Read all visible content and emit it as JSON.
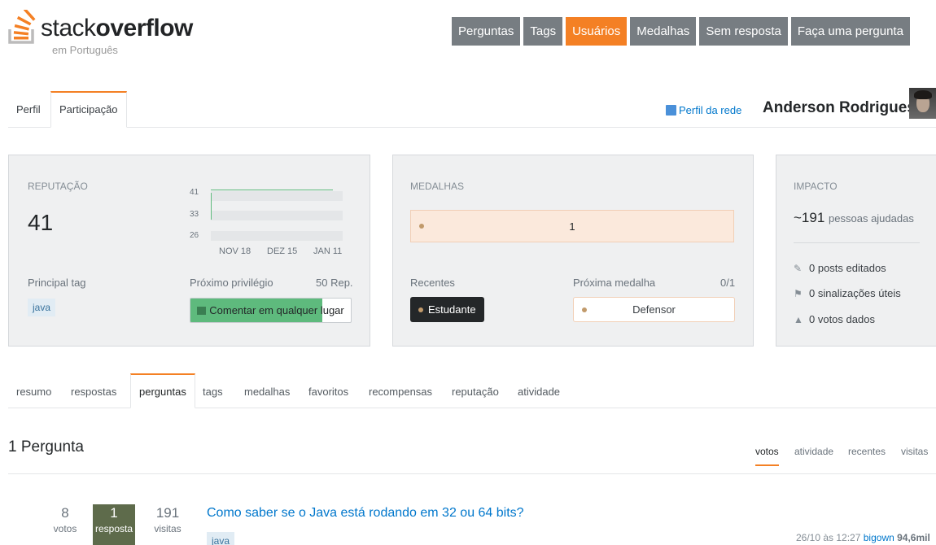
{
  "header": {
    "logo_text_normal": "stack",
    "logo_text_bold": "overflow",
    "logo_sub": "em Português",
    "nav": [
      {
        "label": "Perguntas",
        "active": false
      },
      {
        "label": "Tags",
        "active": false
      },
      {
        "label": "Usuários",
        "active": true
      },
      {
        "label": "Medalhas",
        "active": false
      },
      {
        "label": "Sem resposta",
        "active": false
      },
      {
        "label": "Faça uma pergunta",
        "active": false
      }
    ]
  },
  "profile": {
    "tabs": [
      "Perfil",
      "Participação"
    ],
    "active_tab": "Participação",
    "network_profile_label": "Perfil da rede",
    "user_name": "Anderson Rodrigues"
  },
  "reputation": {
    "label": "REPUTAÇÃO",
    "value": "41",
    "graph": {
      "y_labels": [
        "41",
        "33",
        "26"
      ],
      "x_labels": [
        "NOV 18",
        "DEZ 15",
        "JAN 11"
      ]
    },
    "top_tag_label": "Principal tag",
    "top_tag": "java",
    "next_privilege_label": "Próximo privilégio",
    "next_privilege_rep": "50 Rep.",
    "next_privilege_name": "Comentar em qualquer lugar",
    "next_privilege_progress": 0.82
  },
  "badges": {
    "label": "MEDALHAS",
    "bronze_count": "1",
    "recent_label": "Recentes",
    "recent_badge": "Estudante",
    "next_badge_label": "Próxima medalha",
    "next_badge_progress": "0/1",
    "next_badge_name": "Defensor"
  },
  "impact": {
    "label": "IMPACTO",
    "people_reached": "~191",
    "people_reached_label": "pessoas ajudadas",
    "posts_edited": "0 posts editados",
    "helpful_flags": "0 sinalizações úteis",
    "votes_cast": "0 votos dados"
  },
  "activity_tabs": {
    "items": [
      "resumo",
      "respostas",
      "perguntas",
      "tags",
      "medalhas",
      "favoritos",
      "recompensas",
      "reputação",
      "atividade"
    ],
    "active": "perguntas"
  },
  "questions": {
    "heading": "1 Pergunta",
    "sort_tabs": [
      "votos",
      "atividade",
      "recentes",
      "visitas"
    ],
    "active_sort": "votos",
    "items": [
      {
        "votes": "8",
        "votes_label": "votos",
        "answers": "1",
        "answers_label": "resposta",
        "views": "191",
        "views_label": "visitas",
        "title": "Como saber se o Java está rodando em 32 ou 64 bits?",
        "tag": "java",
        "asked_time": "26/10 às 12:27",
        "user": "bigown",
        "user_rep": "94,6mil"
      }
    ]
  },
  "colors": {
    "accent": "#f48024",
    "nav_bg": "#777d82",
    "link": "#0077cc",
    "progress_green": "#5eba7d",
    "answered_bg": "#5e6b4b"
  }
}
